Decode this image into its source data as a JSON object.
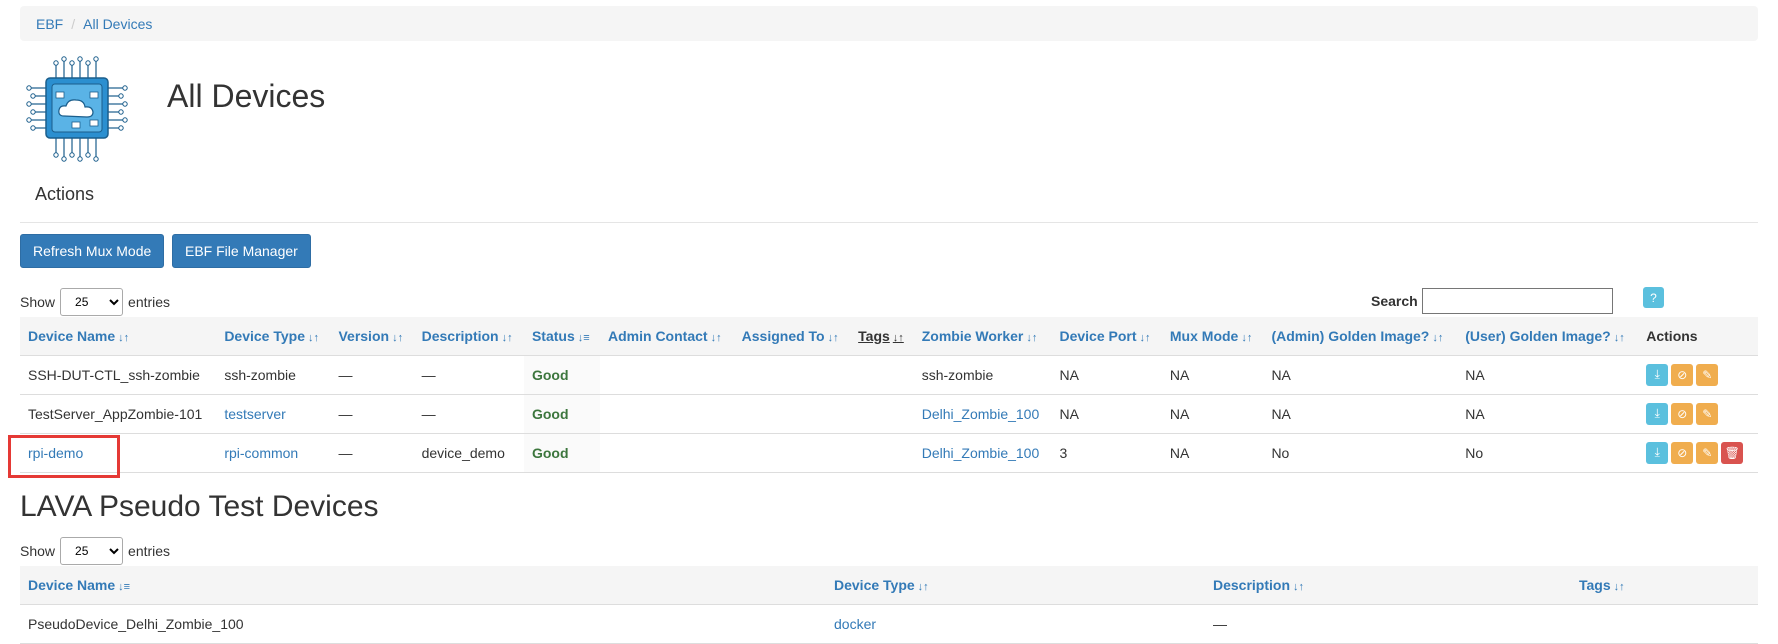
{
  "breadcrumb": {
    "root": "EBF",
    "current": "All Devices"
  },
  "page_title": "All Devices",
  "actions_heading": "Actions",
  "buttons": {
    "refresh": "Refresh Mux Mode",
    "file_manager": "EBF File Manager"
  },
  "devices_table": {
    "show_label": "Show",
    "entries_label": "entries",
    "page_size": "25",
    "search_label": "Search",
    "search_value": "",
    "help": "?",
    "columns": [
      "Device Name",
      "Device Type",
      "Version",
      "Description",
      "Status",
      "Admin Contact",
      "Assigned To",
      "Tags",
      "Zombie Worker",
      "Device Port",
      "Mux Mode",
      "(Admin) Golden Image?",
      "(User) Golden Image?",
      "Actions"
    ],
    "rows": [
      {
        "name": "SSH-DUT-CTL_ssh-zombie",
        "type": "ssh-zombie",
        "version": "—",
        "description": "—",
        "status": "Good",
        "admin": "",
        "assigned": "",
        "tags": "",
        "worker": "ssh-zombie",
        "port": "NA",
        "mux": "NA",
        "admin_golden": "NA",
        "user_golden": "NA"
      },
      {
        "name": "TestServer_AppZombie-101",
        "type": "testserver",
        "version": "—",
        "description": "—",
        "status": "Good",
        "admin": "",
        "assigned": "",
        "tags": "",
        "worker": "Delhi_Zombie_100",
        "port": "NA",
        "mux": "NA",
        "admin_golden": "NA",
        "user_golden": "NA"
      },
      {
        "name": "rpi-demo",
        "type": "rpi-common",
        "version": "—",
        "description": "device_demo",
        "status": "Good",
        "admin": "",
        "assigned": "",
        "tags": "",
        "worker": "Delhi_Zombie_100",
        "port": "3",
        "mux": "NA",
        "admin_golden": "No",
        "user_golden": "No"
      }
    ]
  },
  "pseudo": {
    "title": "LAVA Pseudo Test Devices",
    "show_label": "Show",
    "entries_label": "entries",
    "page_size": "25",
    "columns": [
      "Device Name",
      "Device Type",
      "Description",
      "Tags"
    ],
    "rows": [
      {
        "name": "PseudoDevice_Delhi_Zombie_100",
        "type": "docker",
        "description": "—",
        "tags": ""
      }
    ]
  },
  "colors": {
    "link": "#337ab7",
    "good": "#3c763d",
    "highlight": "#e53935"
  }
}
